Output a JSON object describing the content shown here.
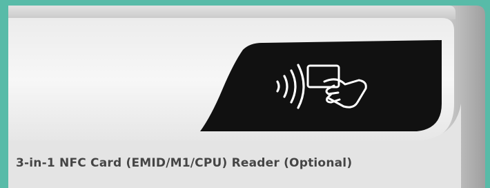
{
  "caption": "3-in-1 NFC Card (EMID/M1/CPU) Reader (Optional)",
  "colors": {
    "background_teal": "#58bba8",
    "device_body": "#f3f3f3",
    "device_side": "#b8b8b8",
    "reader_panel": "#111111",
    "caption_text": "#454545"
  },
  "icons": [
    "nfc-waves-icon",
    "hand-holding-card-icon"
  ]
}
